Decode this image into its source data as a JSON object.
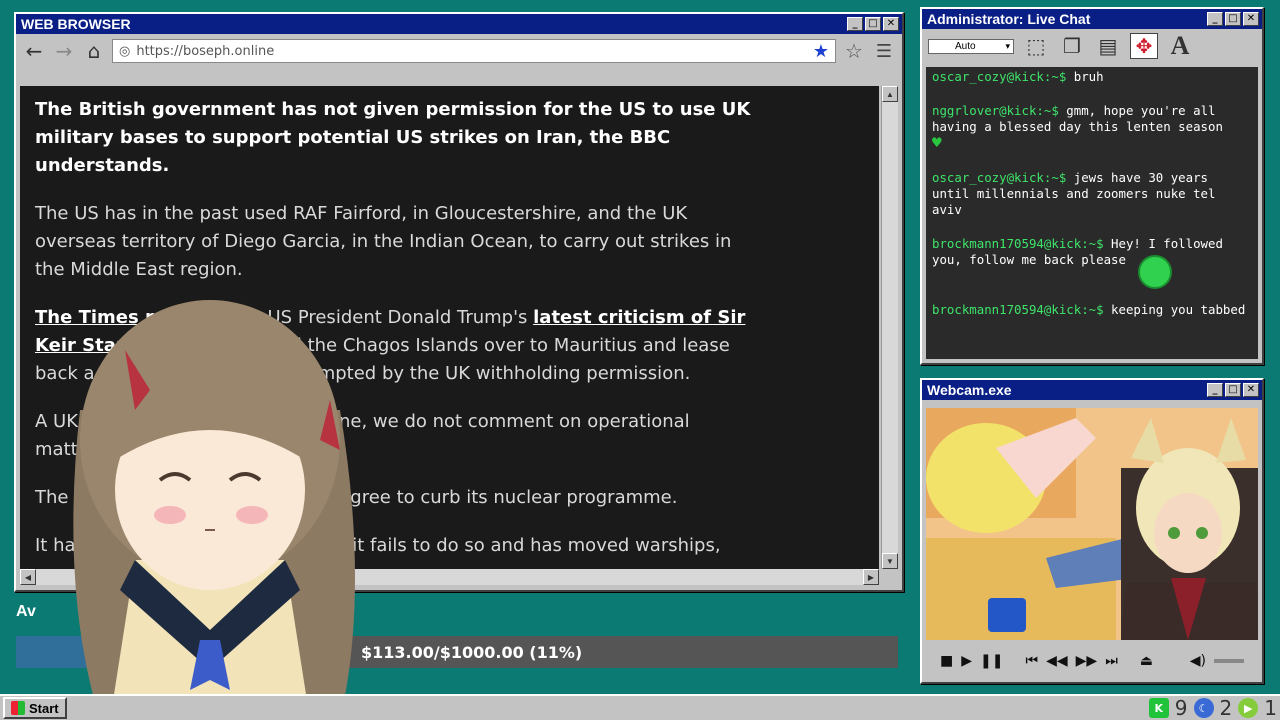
{
  "browser": {
    "title": "WEB BROWSER",
    "url": "https://boseph.online",
    "article": {
      "lead": "The British government has not given permission for the US to use UK military bases to support potential US strikes on Iran, the BBC understands.",
      "p2": "The US has in the past used RAF Fairford, in Gloucestershire, and the UK overseas territory of Diego Garcia, in the Indian Ocean, to carry out strikes in the Middle East region.",
      "p3_link1": "The Times reports",
      "p3_mid": " that US President Donald Trump's ",
      "p3_link2": "latest criticism of Sir Keir Starmer's d",
      "p3_rest": "eal to hand the Chagos Islands over to Mauritius and lease back a joint base there was prompted by the UK withholding permission.",
      "p4": "A UK spokesperson said: \"As routine, we do not comment on operational matters.\"",
      "p5": "The US has been pressing Iran to agree to curb its nuclear programme.",
      "p6": "It has threatened military strikes if it fails to do so and has moved warships,"
    }
  },
  "chat": {
    "title": "Administrator: Live Chat",
    "font_select": "Auto",
    "messages": [
      {
        "user": "oscar_cozy@kick:~$",
        "text": " bruh"
      },
      {
        "user": "nggrlover@kick:~$",
        "text": " gmm, hope you're all having a blessed day this lenten season"
      },
      {
        "user": "oscar_cozy@kick:~$",
        "text": " jews have 30 years until millennials and zoomers nuke tel aviv"
      },
      {
        "user": "brockmann170594@kick:~$",
        "text": " Hey! I followed you, follow me back please"
      },
      {
        "user": "brockmann170594@kick:~$",
        "text": " keeping you tabbed"
      }
    ],
    "heart": "♥",
    "colors": {
      "username": "#3ee46a",
      "background": "#2a2a2a"
    }
  },
  "webcam": {
    "title": "Webcam.exe"
  },
  "donation": {
    "label": "Av",
    "text": "$113.00/$1000.00 (11%)",
    "progress_fraction": 0.11
  },
  "taskbar": {
    "start_label": "Start",
    "tray": [
      {
        "icon": "kick-icon",
        "count": "9"
      },
      {
        "icon": "moon-icon",
        "count": "2"
      },
      {
        "icon": "rumble-icon",
        "count": "1"
      }
    ]
  },
  "icons": {
    "back": "←",
    "forward": "→",
    "home": "⌂",
    "globe": "🌐",
    "star_filled": "★",
    "star_outline": "☆",
    "menu": "☰",
    "minimize": "_",
    "maximize": "□",
    "close": "✕"
  }
}
